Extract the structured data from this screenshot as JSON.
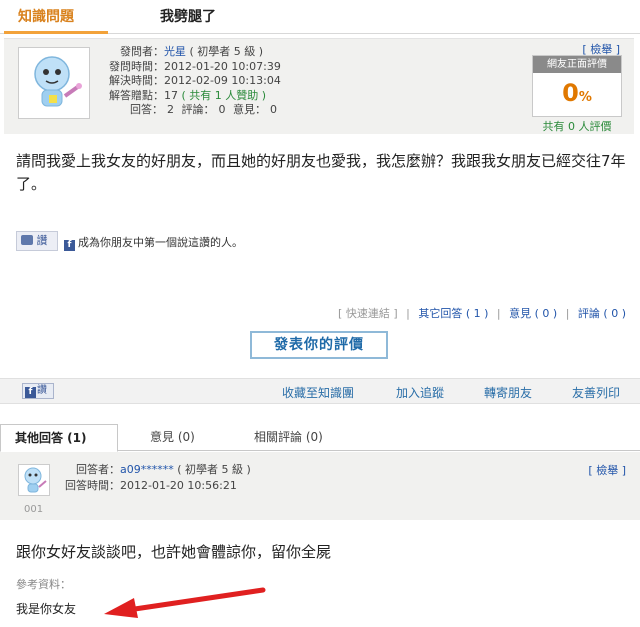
{
  "tabs": {
    "knowledge_label": "知識問題",
    "question_title": "我劈腿了"
  },
  "question_meta": {
    "asker_label": "發問者：",
    "asker_name": "光星",
    "asker_level": "( 初學者 5 級 )",
    "asked_time_label": "發問時間：",
    "asked_time": "2012-01-20 10:07:39",
    "resolved_time_label": "解決時間：",
    "resolved_time": "2012-02-09 10:13:04",
    "points_label": "解答贈點：",
    "points": "17",
    "sponsors": "( 共有 1 人贊助 )",
    "answers_label": "回答：",
    "answers_count": "2",
    "reviews_label": "評論：",
    "reviews_count": "0",
    "opinions_label": "意見：",
    "opinions_count": "0"
  },
  "rating": {
    "report_label": "[ 檢舉 ]",
    "header": "網友正面評價",
    "value": "0",
    "unit": "%",
    "count_text": "共有 0 人評價"
  },
  "question_body": "請問我愛上我女友的好朋友，而且她的好朋友也愛我，我怎麼辦？我跟我女朋友已經交往7年了。",
  "social": {
    "like_label": "讚",
    "first_like_text": "成為你朋友中第一個說這讚的人。",
    "share_label": "讚"
  },
  "links": {
    "quick_link": "[ 快速連結 ]",
    "other_answers": "其它回答 ( 1 )",
    "opinions": "意見 ( 0 )",
    "reviews": "評論 ( 0 )",
    "separator": "|"
  },
  "eval_button": "發表你的評價",
  "actions": {
    "collect": "收藏至知識團",
    "follow": "加入追蹤",
    "forward": "轉寄朋友",
    "print": "友善列印"
  },
  "answer_tabs": {
    "other": "其他回答 (1)",
    "opinion": "意見 (0)",
    "related": "相關評論 (0)"
  },
  "answer": {
    "answerer_label": "回答者：",
    "answerer_name": "a09******",
    "answerer_level": "( 初學者 5 級 )",
    "time_label": "回答時間：",
    "time": "2012-01-20 10:56:21",
    "number": "001",
    "report_label": "[ 檢舉 ]",
    "body": "跟你女好友談談吧，也許她會體諒你，留你全屍",
    "ref_label": "參考資料：",
    "ref_text": "我是你女友"
  },
  "colors": {
    "accent_orange": "#f2a23a",
    "link_blue": "#2255aa",
    "link_green": "#2a8a3a",
    "arrow_red": "#e02020"
  },
  "icons": [
    "mascot-avatar-icon",
    "facebook-like-icon",
    "facebook-f-icon",
    "red-arrow-icon"
  ]
}
